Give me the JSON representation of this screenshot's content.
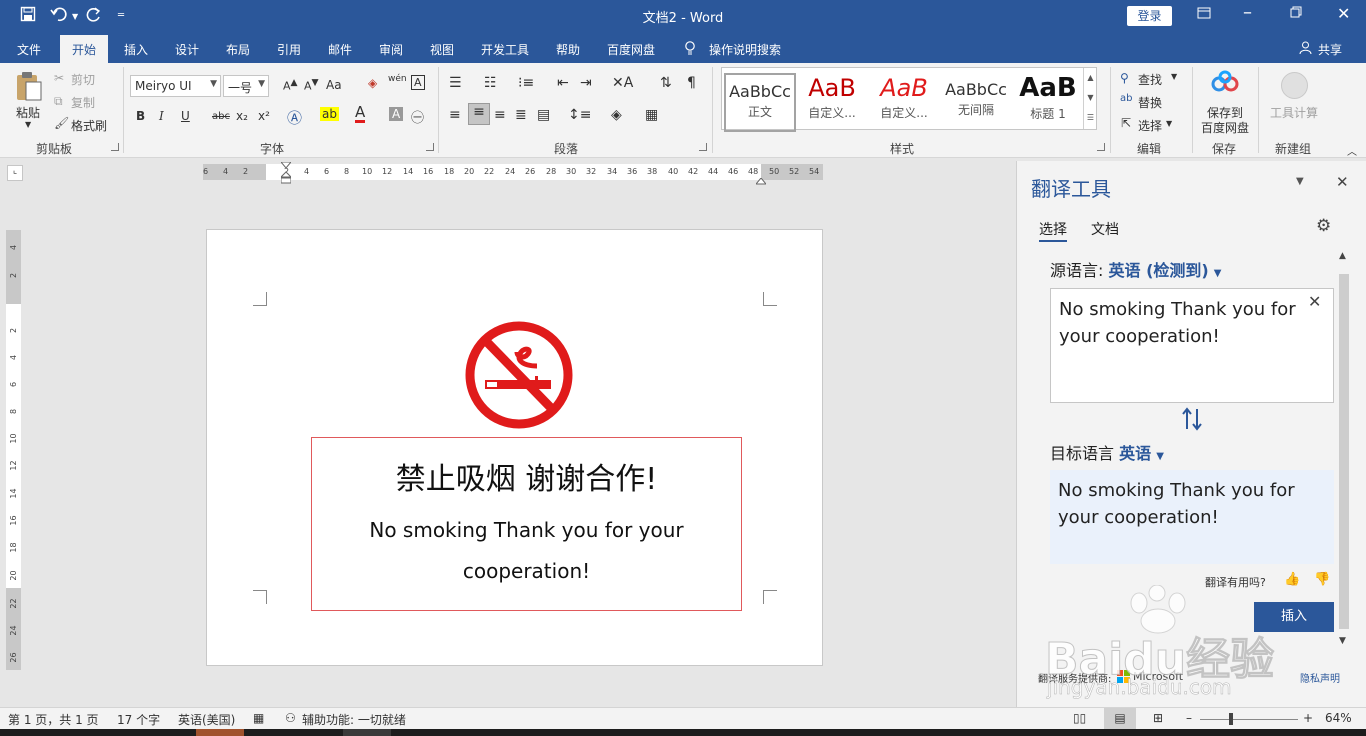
{
  "titlebar": {
    "title": "文档2  -  Word",
    "login": "登录"
  },
  "tabs": [
    "文件",
    "开始",
    "插入",
    "设计",
    "布局",
    "引用",
    "邮件",
    "审阅",
    "视图",
    "开发工具",
    "帮助",
    "百度网盘",
    "操作说明搜索",
    "共享"
  ],
  "ribbon": {
    "clipboard": {
      "paste": "粘贴",
      "cut": "剪切",
      "copy": "复制",
      "format_painter": "格式刷",
      "label": "剪贴板"
    },
    "font": {
      "family": "Meiryo UI",
      "size": "一号",
      "label": "字体",
      "case_btn": "Aa",
      "phonetic": "wén",
      "bold": "B",
      "italic": "I",
      "underline": "U",
      "strike": "abc",
      "sub": "x₂",
      "sup": "x²"
    },
    "paragraph": {
      "label": "段落"
    },
    "styles": {
      "label": "样式",
      "items": [
        {
          "sample": "AaBbCc",
          "name": "正文"
        },
        {
          "sample": "AaB",
          "name": "自定义..."
        },
        {
          "sample": "AaB",
          "name": "自定义..."
        },
        {
          "sample": "AaBbCc",
          "name": "无间隔"
        },
        {
          "sample": "AaB",
          "name": "标题 1"
        }
      ]
    },
    "editing": {
      "find": "查找",
      "replace": "替换",
      "select": "选择",
      "label": "编辑"
    },
    "save": {
      "btn_line1": "保存到",
      "btn_line2": "百度网盘",
      "label": "保存"
    },
    "newgroup": {
      "btn": "工具计算",
      "label": "新建组"
    }
  },
  "ruler_h": [
    "6",
    "4",
    "2",
    "2",
    "4",
    "6",
    "8",
    "10",
    "12",
    "14",
    "16",
    "18",
    "20",
    "22",
    "24",
    "26",
    "28",
    "30",
    "32",
    "34",
    "36",
    "38",
    "40",
    "42",
    "44",
    "46",
    "48",
    "50",
    "52",
    "54"
  ],
  "ruler_v": [
    "4",
    "2",
    "2",
    "4",
    "6",
    "8",
    "10",
    "12",
    "14",
    "16",
    "18",
    "20",
    "22",
    "24",
    "26",
    "28"
  ],
  "document": {
    "cn_text": "禁止吸烟  谢谢合作!",
    "en_line1": "No smoking Thank you for your",
    "en_line2": "cooperation!"
  },
  "translator": {
    "title": "翻译工具",
    "tab_select": "选择",
    "tab_document": "文档",
    "source_label": "源语言:",
    "source_lang": "英语 (检测到)",
    "source_text": "No smoking Thank you for your cooperation!",
    "target_label": "目标语言",
    "target_lang": "英语",
    "target_text": "No smoking Thank you for your cooperation!",
    "feedback": "翻译有用吗?",
    "insert": "插入",
    "provider": "翻译服务提供商:",
    "provider_name": "Microsoft",
    "privacy": "隐私声明"
  },
  "status": {
    "page": "第 1 页，共 1 页",
    "words": "17 个字",
    "lang": "英语(美国)",
    "accessibility": "辅助功能: 一切就绪",
    "zoom": "64%"
  },
  "watermark": {
    "brand": "Baidu经验",
    "url": "jingyan.baidu.com"
  },
  "colors": {
    "accent": "#2b579a",
    "nosmoke": "#e01b1b",
    "textbox_border": "#e0595b"
  }
}
